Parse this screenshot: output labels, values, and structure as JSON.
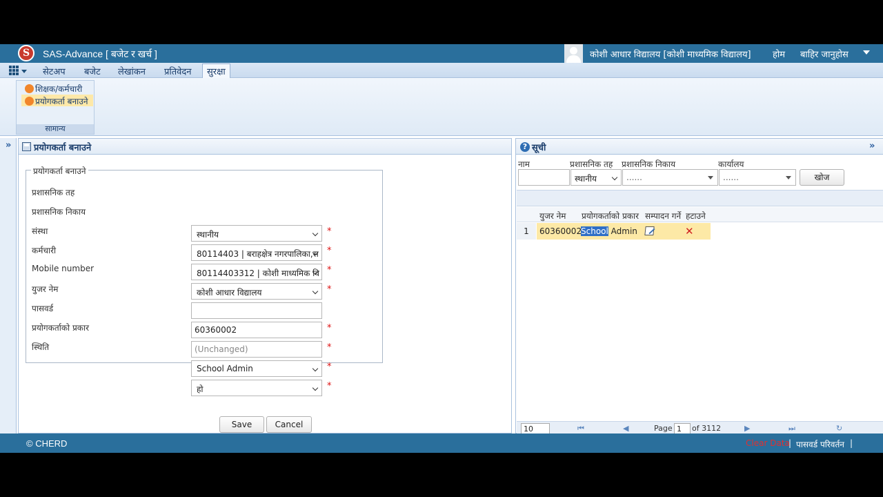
{
  "titlebar": {
    "app_title": "SAS-Advance [ बजेट र खर्च ]",
    "logo_letter": "S",
    "school_name": "कोशी आधार विद्यालय [कोशी माध्यमिक विद्यालय]",
    "home": "होम",
    "logout": "बाहिर जानुहोस"
  },
  "menu": {
    "items": [
      "सेटअप",
      "बजेट",
      "लेखांकन",
      "प्रतिवेदन",
      "सुरक्षा"
    ],
    "active": "सुरक्षा"
  },
  "ribbon": {
    "buttons": [
      "शिक्षक/कर्मचारी",
      "प्रयोगकर्ता बनाउने"
    ],
    "group_label": "सामान्य"
  },
  "form": {
    "panel_title": "प्रयोगकर्ता बनाउने",
    "legend": "प्रयोगकर्ता बनाउने",
    "fields": {
      "admin_level": {
        "label": "प्रशासनिक तह",
        "value": "स्थानीय"
      },
      "admin_body": {
        "label": "प्रशासनिक निकाय",
        "value": "80114403 | बराहक्षेत्र नगरपालिका,स"
      },
      "institution": {
        "label": "संस्था",
        "value": "80114403312 | कोशी माध्यमिक वि"
      },
      "employee": {
        "label": "कर्मचारी",
        "value": "कोशी आधार विद्यालय"
      },
      "mobile": {
        "label": "Mobile number",
        "value": ""
      },
      "username": {
        "label": "युजर नेम",
        "value": "60360002"
      },
      "password": {
        "label": "पासवर्ड",
        "placeholder": "(Unchanged)"
      },
      "user_type": {
        "label": "प्रयोगकर्ताको प्रकार",
        "value": "School Admin"
      },
      "status": {
        "label": "स्थिति",
        "value": "हो"
      }
    },
    "required_mark": "*",
    "save": "Save",
    "cancel": "Cancel"
  },
  "list": {
    "title": "सूची",
    "help_glyph": "?",
    "filters": {
      "name_label": "नाम",
      "level_label": "प्रशासनिक तह",
      "level_value": "स्थानीय",
      "body_label": "प्रशासनिक निकाय",
      "body_value": "......",
      "office_label": "कार्यालय",
      "office_value": "......",
      "search": "खोज"
    },
    "columns": [
      "युजर नेम",
      "प्रयोगकर्ताको प्रकार",
      "सम्पादन गर्ने",
      "हटाउने"
    ],
    "rows": [
      {
        "num": "1",
        "username": "60360002",
        "type_hl": "School",
        "type_rest": " Admin"
      }
    ],
    "pager": {
      "page_size": "10",
      "page_label": "Page",
      "page": "1",
      "of_label": "of 3112"
    }
  },
  "footer": {
    "copyright": "© CHERD",
    "clear_data": "Clear Data",
    "change_password": "पासवर्ड परिवर्तन",
    "separator": "|"
  },
  "colors": {
    "brand": "#2a6f9c",
    "required": "#dd1111",
    "row_highlight": "#fde9a6",
    "clear_data": "#e03030"
  }
}
